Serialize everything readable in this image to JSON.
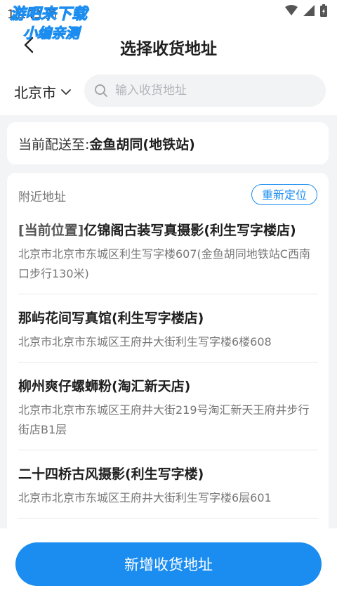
{
  "status_bar": {
    "time": "11:43",
    "carrier_glyph": "药"
  },
  "watermark": {
    "line1": "游吧来下载",
    "line2": "小编亲测"
  },
  "header": {
    "title": "选择收货地址"
  },
  "search": {
    "city": "北京市",
    "placeholder": "输入收货地址"
  },
  "current": {
    "label": "当前配送至:",
    "value": "金鱼胡同(地铁站)"
  },
  "nearby": {
    "title": "附近地址",
    "relocate_label": "重新定位",
    "items": [
      {
        "prefix": "[当前位置]",
        "name": "亿锦阁古装写真摄影(利生写字楼店)",
        "address": "北京市北京市东城区利生写字楼607(金鱼胡同地铁站C西南口步行130米)"
      },
      {
        "prefix": "",
        "name": "那屿花间写真馆(利生写字楼店)",
        "address": "北京市北京市东城区王府井大街利生写字楼6楼608"
      },
      {
        "prefix": "",
        "name": "柳州爽仔螺蛳粉(淘汇新天店)",
        "address": "北京市北京市东城区王府井大街219号淘汇新天王府井步行街店B1层"
      },
      {
        "prefix": "",
        "name": "二十四桥古风摄影(利生写字楼)",
        "address": "北京市北京市东城区王府井大街利生写字楼6层601"
      }
    ]
  },
  "bottom": {
    "add_label": "新增收货地址"
  },
  "colors": {
    "accent": "#1b8df0",
    "background": "#f3f4f6"
  },
  "icons": {
    "back": "chevron-left-icon",
    "search": "search-icon",
    "dropdown": "chevron-down-icon",
    "wifi": "wifi-icon",
    "signal": "signal-icon",
    "battery": "battery-icon"
  }
}
